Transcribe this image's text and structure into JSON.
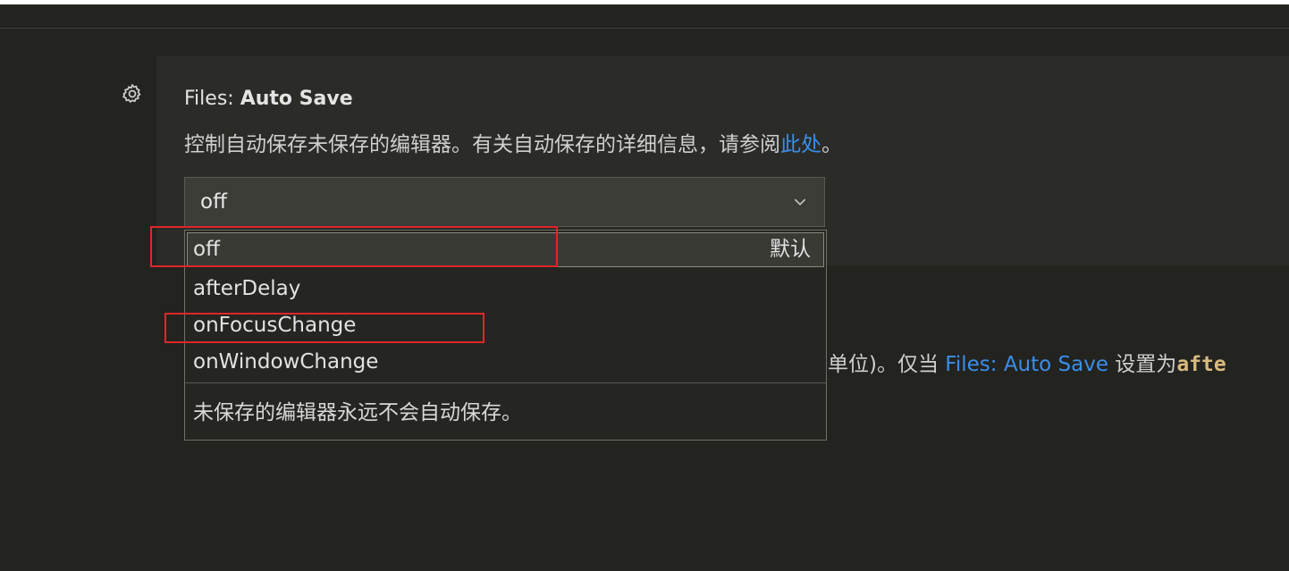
{
  "setting": {
    "category": "Files: ",
    "key": "Auto Save",
    "description_prefix": "控制自动保存未保存的编辑器。有关自动保存的详细信息，请参阅",
    "description_link": "此处",
    "description_suffix": "。",
    "current_value": "off"
  },
  "dropdown": {
    "options": [
      {
        "label": "off",
        "badge": "默认"
      },
      {
        "label": "afterDelay"
      },
      {
        "label": "onFocusChange"
      },
      {
        "label": "onWindowChange"
      }
    ],
    "selected_description": "未保存的编辑器永远不会自动保存。"
  },
  "next_setting": {
    "desc_prefix": "单位)。仅当 ",
    "desc_link": "Files: Auto Save",
    "desc_mid": " 设置为",
    "desc_code": "afte"
  },
  "colors": {
    "background": "#232320",
    "link": "#3b8eea",
    "highlight": "#e0262a"
  },
  "icons": {
    "gear": "gear-icon",
    "chevron": "chevron-down-icon"
  }
}
